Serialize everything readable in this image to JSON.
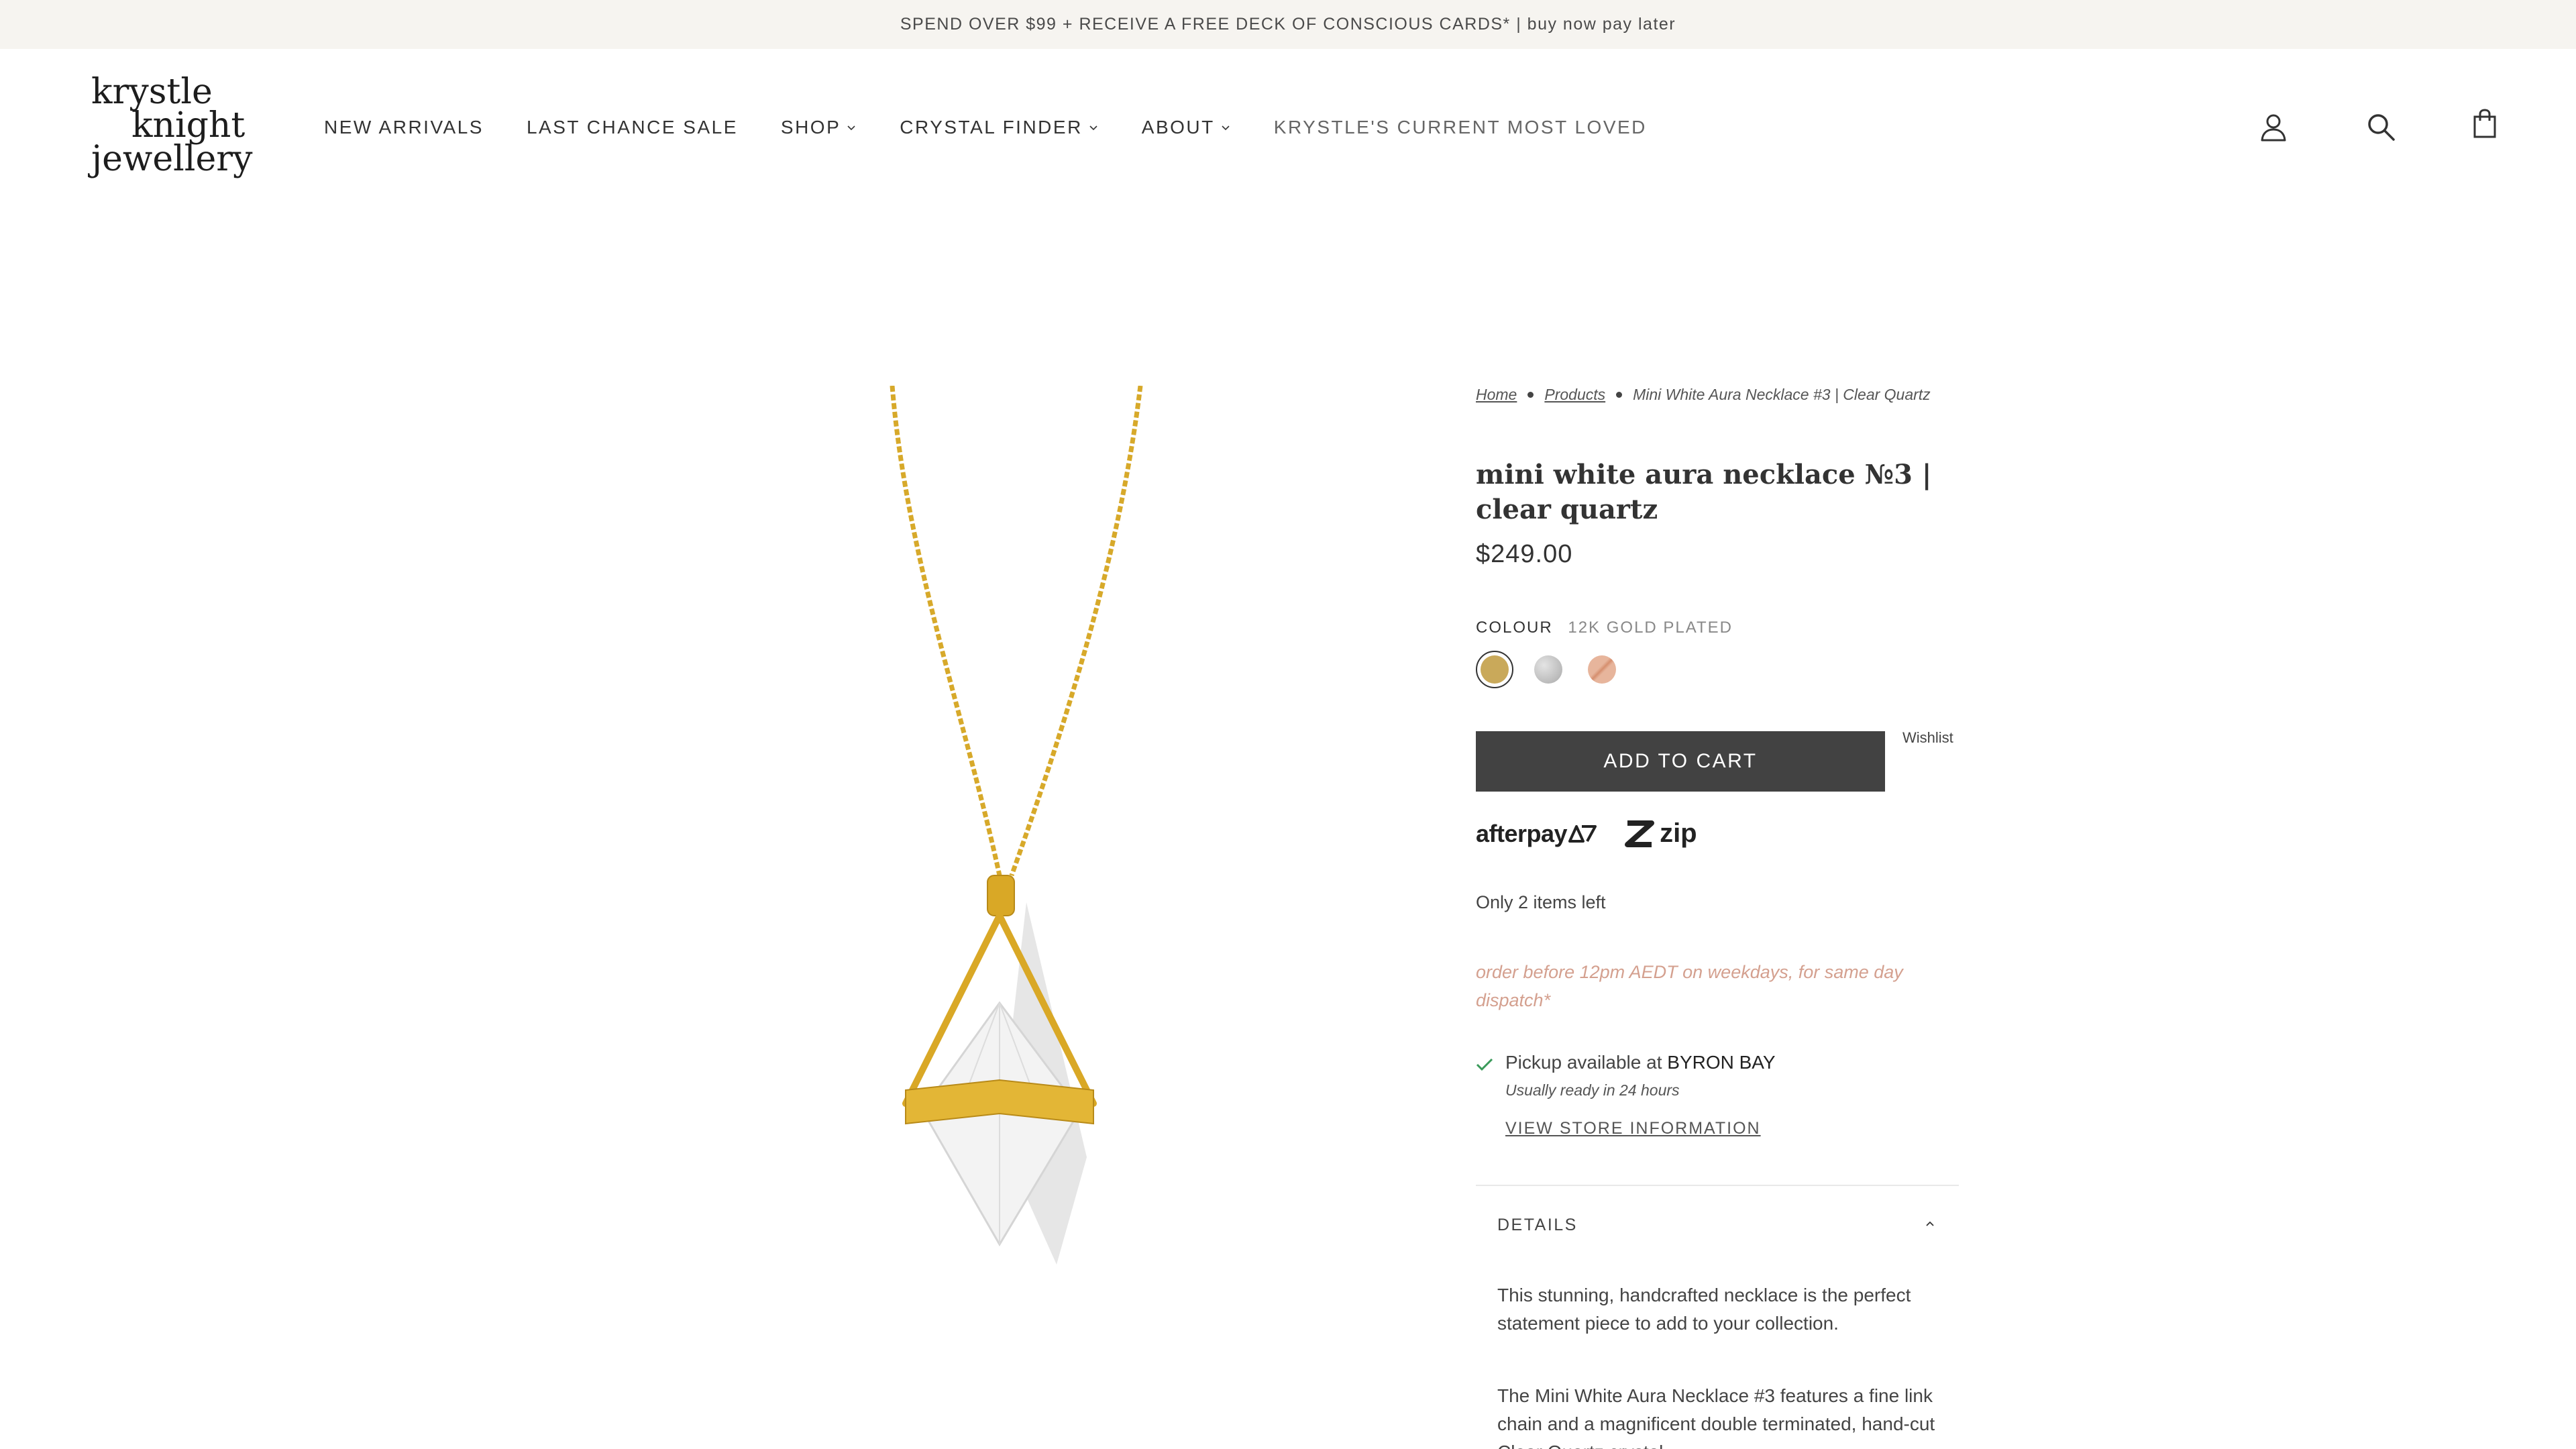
{
  "announcement": "SPEND OVER $99 + RECEIVE A FREE DECK OF CONSCIOUS CARDS* | buy now pay later",
  "logo": {
    "line1": "krystle",
    "line2": "knight",
    "line3": "jewellery"
  },
  "nav": {
    "new_arrivals": "NEW ARRIVALS",
    "last_chance": "LAST CHANCE SALE",
    "shop": "SHOP",
    "crystal_finder": "CRYSTAL FINDER",
    "about": "ABOUT",
    "most_loved": "KRYSTLE'S CURRENT MOST LOVED"
  },
  "icons": {
    "account": "user-icon",
    "search": "search-icon",
    "cart": "bag-icon"
  },
  "breadcrumb": {
    "home": "Home",
    "products": "Products",
    "current": "Mini White Aura Necklace #3 | Clear Quartz"
  },
  "product": {
    "title": "mini white aura necklace №3 | clear quartz",
    "price": "$249.00",
    "colour_label": "COLOUR",
    "colour_value": "12K GOLD PLATED",
    "swatches": [
      {
        "name": "gold",
        "color": "#c9a95a",
        "selected": true
      },
      {
        "name": "silver",
        "color": "#b9b9b9",
        "selected": false
      },
      {
        "name": "rose-gold",
        "color": "#e2a88d",
        "selected": false
      }
    ],
    "add_to_cart": "ADD TO CART",
    "wishlist": "Wishlist",
    "afterpay": "afterpay",
    "zip": "zip",
    "stock": "Only 2 items left",
    "dispatch": "order before 12pm AEDT on weekdays, for same day dispatch*"
  },
  "pickup": {
    "prefix": "Pickup available at",
    "location": "BYRON BAY",
    "sub": "Usually ready in 24 hours",
    "view_store": "VIEW STORE INFORMATION"
  },
  "details": {
    "heading": "DETAILS",
    "p1": "This stunning, handcrafted necklace is the perfect statement piece to add to your collection.",
    "p2": "The Mini White Aura Necklace #3 features a fine link chain and a magnificent double terminated, hand-cut Clear Quartz crystal."
  },
  "colors": {
    "accent_dark": "#424242",
    "dispatch_text": "#d4a08f",
    "check_green": "#3a9a5a"
  }
}
